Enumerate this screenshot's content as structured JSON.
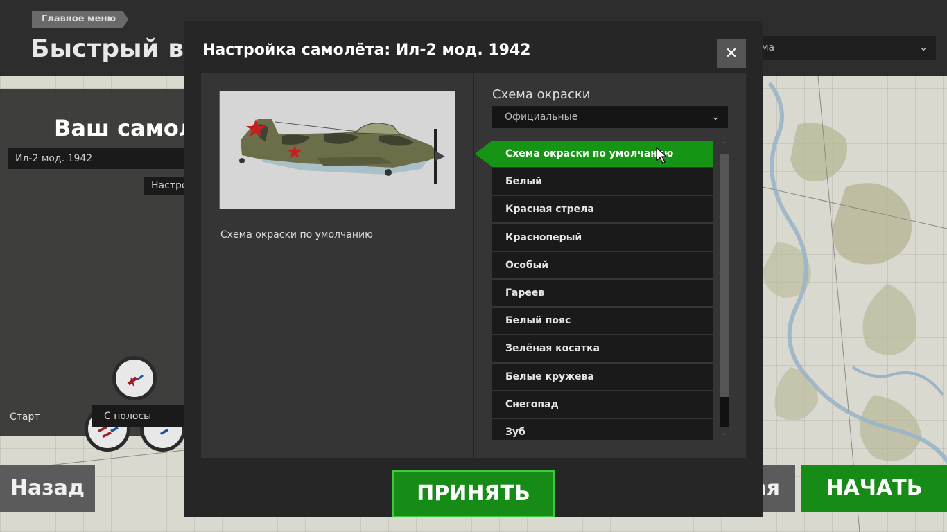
{
  "header": {
    "breadcrumb": "Главное меню",
    "page_title": "Быстрый вылет",
    "top_select_value": "ма"
  },
  "left_panel": {
    "title": "Ваш самолёт",
    "plane_select": "Ил-2 мод. 1942",
    "setup_button": "Настроить",
    "start_label": "Старт",
    "start_select": "С полосы"
  },
  "footer": {
    "back_label": "Назад",
    "mid_label": "ая",
    "start_label": "НАЧАТЬ"
  },
  "modal": {
    "title": "Настройка самолёта: Ил-2 мод. 1942",
    "close_icon": "close-icon",
    "preview_caption": "Схема окраски по умолчанию",
    "scheme_label": "Схема окраски",
    "scheme_category": "Официальные",
    "skins": [
      "Схема окраски по умолчанию",
      "Белый",
      "Красная стрела",
      "Красноперый",
      "Особый",
      "Гареев",
      "Белый пояс",
      "Зелёная косатка",
      "Белые кружева",
      "Снегопад",
      "Зуб"
    ],
    "selected_skin_index": 0,
    "accept_label": "ПРИНЯТЬ"
  },
  "colors": {
    "accent_green": "#159415",
    "panel_dark": "#262626",
    "item_bg": "#1a1a1a"
  }
}
